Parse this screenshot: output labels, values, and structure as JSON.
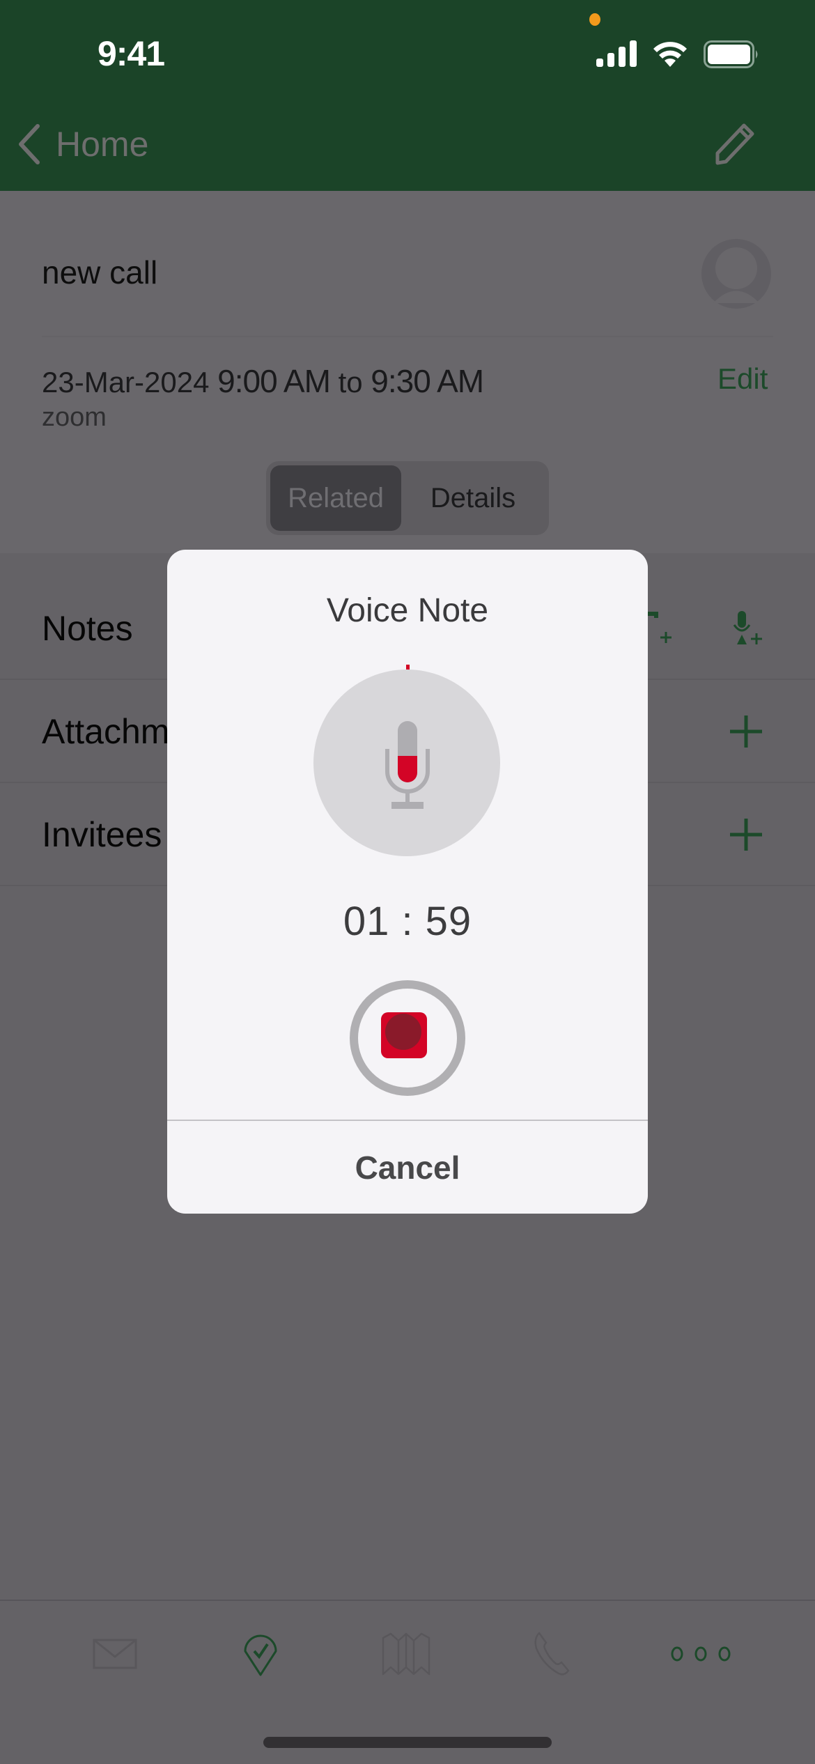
{
  "status_bar": {
    "time": "9:41",
    "mic_indicator_color": "#f29a1c"
  },
  "nav": {
    "back_label": "Home",
    "back_icon": "chevron-left-icon",
    "edit_icon": "pencil-icon",
    "bar_color": "#1b4428"
  },
  "record": {
    "title": "new call",
    "date": "23-Mar-2024",
    "start_time": "9:00 AM",
    "to_label": "to",
    "end_time": "9:30 AM",
    "location": "zoom",
    "edit_label": "Edit"
  },
  "segments": [
    {
      "label": "Related",
      "active": true
    },
    {
      "label": "Details",
      "active": false
    }
  ],
  "related_rows": [
    {
      "label": "Notes",
      "actions": [
        "add-text-note-icon",
        "add-voice-note-icon"
      ]
    },
    {
      "label": "Attachments",
      "visible_label": "Attachm",
      "actions": [
        "plus-icon"
      ]
    },
    {
      "label": "Invitees",
      "actions": [
        "plus-icon"
      ]
    }
  ],
  "tabbar": {
    "items": [
      {
        "name": "mail",
        "icon": "envelope-icon",
        "active": false
      },
      {
        "name": "check-in",
        "icon": "location-check-icon",
        "active": true
      },
      {
        "name": "map",
        "icon": "map-icon",
        "active": false
      },
      {
        "name": "call",
        "icon": "phone-icon",
        "active": false
      },
      {
        "name": "more",
        "icon": "more-dots-icon",
        "active": true
      }
    ]
  },
  "voice_note_modal": {
    "title": "Voice Note",
    "timer": "01 : 59",
    "recording": true,
    "cancel_label": "Cancel",
    "accent_color": "#d30426"
  },
  "colors": {
    "brand_green": "#1b4428",
    "overlay": "#636165",
    "record_red": "#d30426"
  }
}
